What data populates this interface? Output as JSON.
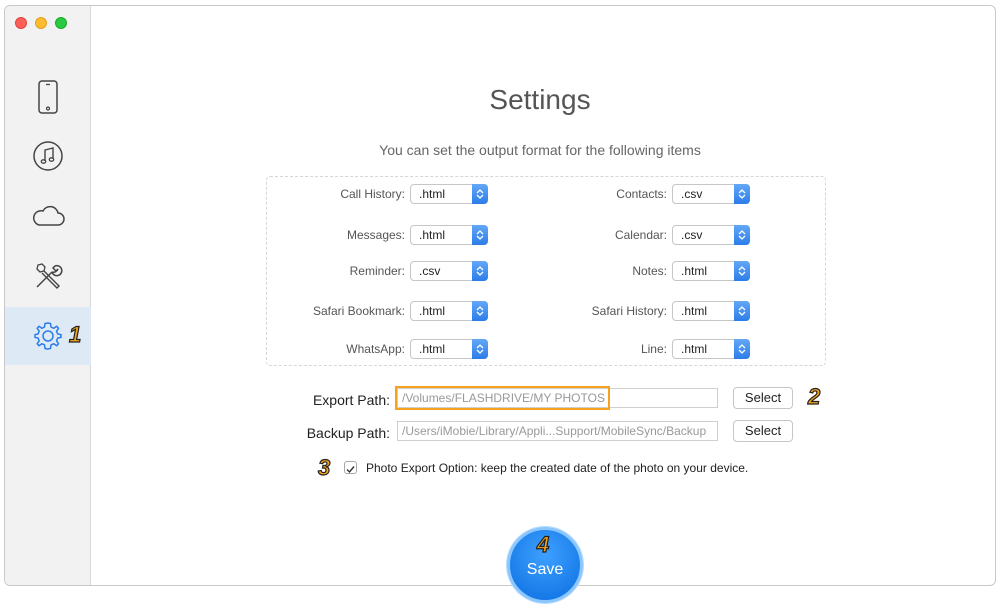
{
  "window": {
    "title": "Settings",
    "subtitle": "You can set the output format for the following items"
  },
  "sidebar": {
    "items": [
      {
        "name": "device",
        "icon": "phone-icon"
      },
      {
        "name": "music",
        "icon": "music-note-icon"
      },
      {
        "name": "icloud",
        "icon": "cloud-icon"
      },
      {
        "name": "tools",
        "icon": "tools-icon"
      },
      {
        "name": "settings",
        "icon": "gear-icon",
        "active": true
      }
    ]
  },
  "formats": {
    "left": [
      {
        "label": "Call History:",
        "value": ".html"
      },
      {
        "label": "Messages:",
        "value": ".html"
      },
      {
        "label": "Reminder:",
        "value": ".csv"
      },
      {
        "label": "Safari Bookmark:",
        "value": ".html"
      },
      {
        "label": "WhatsApp:",
        "value": ".html"
      }
    ],
    "right": [
      {
        "label": "Contacts:",
        "value": ".csv"
      },
      {
        "label": "Calendar:",
        "value": ".csv"
      },
      {
        "label": "Notes:",
        "value": ".html"
      },
      {
        "label": "Safari History:",
        "value": ".html"
      },
      {
        "label": "Line:",
        "value": ".html"
      }
    ]
  },
  "paths": {
    "export_label": "Export Path:",
    "export_value": "/Volumes/FLASHDRIVE/MY PHOTOS",
    "backup_label": "Backup Path:",
    "backup_value": "/Users/iMobie/Library/Appli...Support/MobileSync/Backup",
    "select_label": "Select"
  },
  "photo_option": {
    "checked": true,
    "label": "Photo Export Option: keep the created date of the photo on your device."
  },
  "save_label": "Save",
  "annotations": [
    "1",
    "2",
    "3",
    "4"
  ],
  "colors": {
    "accent": "#2d7de9",
    "highlight": "#f5a21c",
    "sidebar_active": "#dde9f5"
  }
}
